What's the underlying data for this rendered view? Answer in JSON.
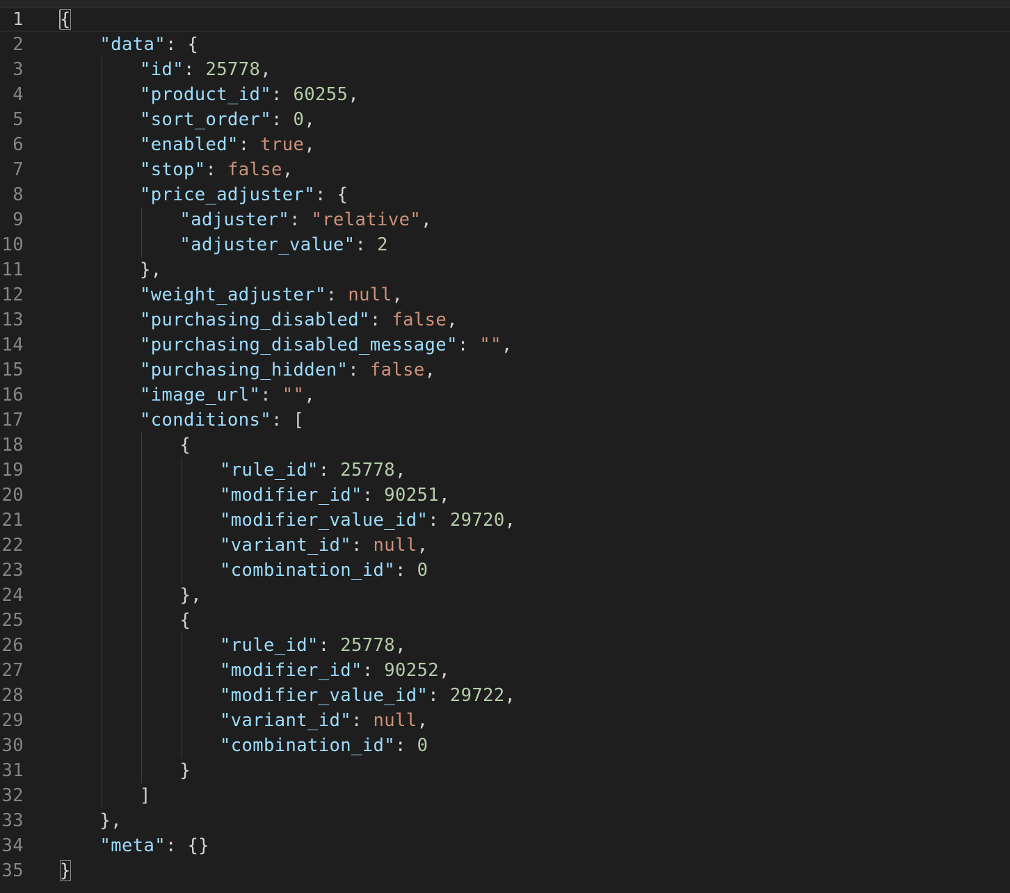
{
  "editor": {
    "language": "json",
    "active_line": 1,
    "colors": {
      "background": "#1e1e1e",
      "key": "#9cdcfe",
      "string": "#ce9178",
      "number": "#b5cea8",
      "keyword": "#ce9178",
      "punctuation": "#d4d4d4",
      "line_number": "#858585",
      "indent_guide": "#404040"
    },
    "lines": [
      {
        "n": "1",
        "indent": 0,
        "tokens": [
          {
            "t": "{",
            "k": "punc"
          }
        ]
      },
      {
        "n": "2",
        "indent": 1,
        "tokens": [
          {
            "t": "\"data\"",
            "k": "key"
          },
          {
            "t": ": {",
            "k": "punc"
          }
        ]
      },
      {
        "n": "3",
        "indent": 2,
        "tokens": [
          {
            "t": "\"id\"",
            "k": "key"
          },
          {
            "t": ": ",
            "k": "punc"
          },
          {
            "t": "25778",
            "k": "num"
          },
          {
            "t": ",",
            "k": "punc"
          }
        ]
      },
      {
        "n": "4",
        "indent": 2,
        "tokens": [
          {
            "t": "\"product_id\"",
            "k": "key"
          },
          {
            "t": ": ",
            "k": "punc"
          },
          {
            "t": "60255",
            "k": "num"
          },
          {
            "t": ",",
            "k": "punc"
          }
        ]
      },
      {
        "n": "5",
        "indent": 2,
        "tokens": [
          {
            "t": "\"sort_order\"",
            "k": "key"
          },
          {
            "t": ": ",
            "k": "punc"
          },
          {
            "t": "0",
            "k": "num"
          },
          {
            "t": ",",
            "k": "punc"
          }
        ]
      },
      {
        "n": "6",
        "indent": 2,
        "tokens": [
          {
            "t": "\"enabled\"",
            "k": "key"
          },
          {
            "t": ": ",
            "k": "punc"
          },
          {
            "t": "true",
            "k": "kw"
          },
          {
            "t": ",",
            "k": "punc"
          }
        ]
      },
      {
        "n": "7",
        "indent": 2,
        "tokens": [
          {
            "t": "\"stop\"",
            "k": "key"
          },
          {
            "t": ": ",
            "k": "punc"
          },
          {
            "t": "false",
            "k": "kw"
          },
          {
            "t": ",",
            "k": "punc"
          }
        ]
      },
      {
        "n": "8",
        "indent": 2,
        "tokens": [
          {
            "t": "\"price_adjuster\"",
            "k": "key"
          },
          {
            "t": ": {",
            "k": "punc"
          }
        ]
      },
      {
        "n": "9",
        "indent": 3,
        "tokens": [
          {
            "t": "\"adjuster\"",
            "k": "key"
          },
          {
            "t": ": ",
            "k": "punc"
          },
          {
            "t": "\"relative\"",
            "k": "str"
          },
          {
            "t": ",",
            "k": "punc"
          }
        ]
      },
      {
        "n": "10",
        "indent": 3,
        "tokens": [
          {
            "t": "\"adjuster_value\"",
            "k": "key"
          },
          {
            "t": ": ",
            "k": "punc"
          },
          {
            "t": "2",
            "k": "num"
          }
        ]
      },
      {
        "n": "11",
        "indent": 2,
        "tokens": [
          {
            "t": "},",
            "k": "punc"
          }
        ]
      },
      {
        "n": "12",
        "indent": 2,
        "tokens": [
          {
            "t": "\"weight_adjuster\"",
            "k": "key"
          },
          {
            "t": ": ",
            "k": "punc"
          },
          {
            "t": "null",
            "k": "kw"
          },
          {
            "t": ",",
            "k": "punc"
          }
        ]
      },
      {
        "n": "13",
        "indent": 2,
        "tokens": [
          {
            "t": "\"purchasing_disabled\"",
            "k": "key"
          },
          {
            "t": ": ",
            "k": "punc"
          },
          {
            "t": "false",
            "k": "kw"
          },
          {
            "t": ",",
            "k": "punc"
          }
        ]
      },
      {
        "n": "14",
        "indent": 2,
        "tokens": [
          {
            "t": "\"purchasing_disabled_message\"",
            "k": "key"
          },
          {
            "t": ": ",
            "k": "punc"
          },
          {
            "t": "\"\"",
            "k": "str"
          },
          {
            "t": ",",
            "k": "punc"
          }
        ]
      },
      {
        "n": "15",
        "indent": 2,
        "tokens": [
          {
            "t": "\"purchasing_hidden\"",
            "k": "key"
          },
          {
            "t": ": ",
            "k": "punc"
          },
          {
            "t": "false",
            "k": "kw"
          },
          {
            "t": ",",
            "k": "punc"
          }
        ]
      },
      {
        "n": "16",
        "indent": 2,
        "tokens": [
          {
            "t": "\"image_url\"",
            "k": "key"
          },
          {
            "t": ": ",
            "k": "punc"
          },
          {
            "t": "\"\"",
            "k": "str"
          },
          {
            "t": ",",
            "k": "punc"
          }
        ]
      },
      {
        "n": "17",
        "indent": 2,
        "tokens": [
          {
            "t": "\"conditions\"",
            "k": "key"
          },
          {
            "t": ": [",
            "k": "punc"
          }
        ]
      },
      {
        "n": "18",
        "indent": 3,
        "tokens": [
          {
            "t": "{",
            "k": "punc"
          }
        ]
      },
      {
        "n": "19",
        "indent": 4,
        "tokens": [
          {
            "t": "\"rule_id\"",
            "k": "key"
          },
          {
            "t": ": ",
            "k": "punc"
          },
          {
            "t": "25778",
            "k": "num"
          },
          {
            "t": ",",
            "k": "punc"
          }
        ]
      },
      {
        "n": "20",
        "indent": 4,
        "tokens": [
          {
            "t": "\"modifier_id\"",
            "k": "key"
          },
          {
            "t": ": ",
            "k": "punc"
          },
          {
            "t": "90251",
            "k": "num"
          },
          {
            "t": ",",
            "k": "punc"
          }
        ]
      },
      {
        "n": "21",
        "indent": 4,
        "tokens": [
          {
            "t": "\"modifier_value_id\"",
            "k": "key"
          },
          {
            "t": ": ",
            "k": "punc"
          },
          {
            "t": "29720",
            "k": "num"
          },
          {
            "t": ",",
            "k": "punc"
          }
        ]
      },
      {
        "n": "22",
        "indent": 4,
        "tokens": [
          {
            "t": "\"variant_id\"",
            "k": "key"
          },
          {
            "t": ": ",
            "k": "punc"
          },
          {
            "t": "null",
            "k": "kw"
          },
          {
            "t": ",",
            "k": "punc"
          }
        ]
      },
      {
        "n": "23",
        "indent": 4,
        "tokens": [
          {
            "t": "\"combination_id\"",
            "k": "key"
          },
          {
            "t": ": ",
            "k": "punc"
          },
          {
            "t": "0",
            "k": "num"
          }
        ]
      },
      {
        "n": "24",
        "indent": 3,
        "tokens": [
          {
            "t": "},",
            "k": "punc"
          }
        ]
      },
      {
        "n": "25",
        "indent": 3,
        "tokens": [
          {
            "t": "{",
            "k": "punc"
          }
        ]
      },
      {
        "n": "26",
        "indent": 4,
        "tokens": [
          {
            "t": "\"rule_id\"",
            "k": "key"
          },
          {
            "t": ": ",
            "k": "punc"
          },
          {
            "t": "25778",
            "k": "num"
          },
          {
            "t": ",",
            "k": "punc"
          }
        ]
      },
      {
        "n": "27",
        "indent": 4,
        "tokens": [
          {
            "t": "\"modifier_id\"",
            "k": "key"
          },
          {
            "t": ": ",
            "k": "punc"
          },
          {
            "t": "90252",
            "k": "num"
          },
          {
            "t": ",",
            "k": "punc"
          }
        ]
      },
      {
        "n": "28",
        "indent": 4,
        "tokens": [
          {
            "t": "\"modifier_value_id\"",
            "k": "key"
          },
          {
            "t": ": ",
            "k": "punc"
          },
          {
            "t": "29722",
            "k": "num"
          },
          {
            "t": ",",
            "k": "punc"
          }
        ]
      },
      {
        "n": "29",
        "indent": 4,
        "tokens": [
          {
            "t": "\"variant_id\"",
            "k": "key"
          },
          {
            "t": ": ",
            "k": "punc"
          },
          {
            "t": "null",
            "k": "kw"
          },
          {
            "t": ",",
            "k": "punc"
          }
        ]
      },
      {
        "n": "30",
        "indent": 4,
        "tokens": [
          {
            "t": "\"combination_id\"",
            "k": "key"
          },
          {
            "t": ": ",
            "k": "punc"
          },
          {
            "t": "0",
            "k": "num"
          }
        ]
      },
      {
        "n": "31",
        "indent": 3,
        "tokens": [
          {
            "t": "}",
            "k": "punc"
          }
        ]
      },
      {
        "n": "32",
        "indent": 2,
        "tokens": [
          {
            "t": "]",
            "k": "punc"
          }
        ]
      },
      {
        "n": "33",
        "indent": 1,
        "tokens": [
          {
            "t": "},",
            "k": "punc"
          }
        ]
      },
      {
        "n": "34",
        "indent": 1,
        "tokens": [
          {
            "t": "\"meta\"",
            "k": "key"
          },
          {
            "t": ": {}",
            "k": "punc"
          }
        ]
      },
      {
        "n": "35",
        "indent": 0,
        "tokens": [
          {
            "t": "}",
            "k": "punc"
          }
        ]
      }
    ]
  }
}
